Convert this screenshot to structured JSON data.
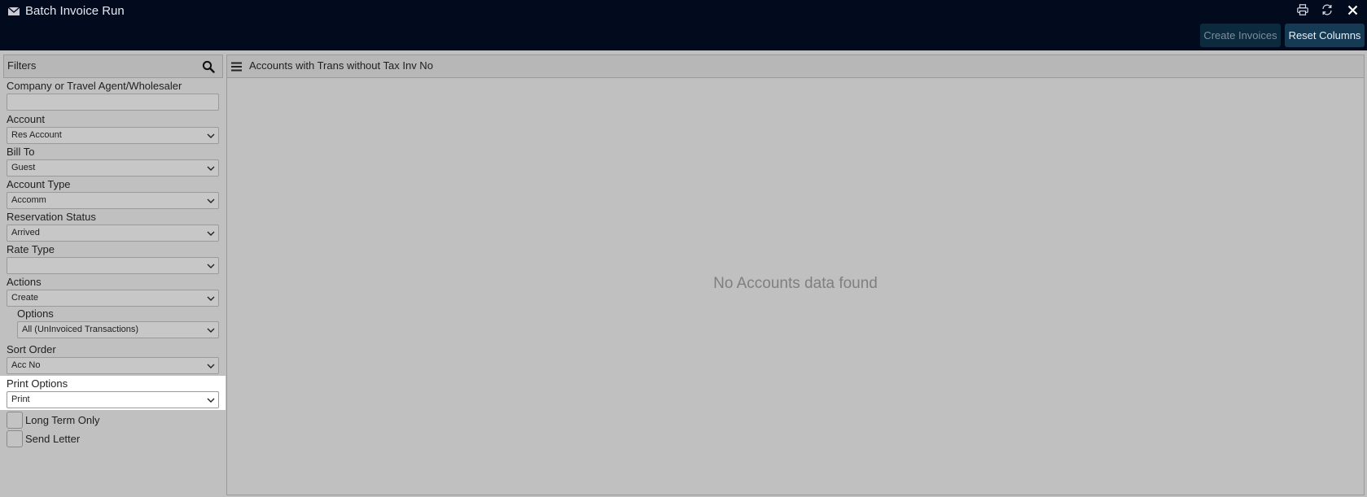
{
  "window": {
    "title": "Batch Invoice Run",
    "icons": [
      "mail-icon",
      "print-icon",
      "refresh-icon",
      "close-icon"
    ]
  },
  "toolbar": {
    "create_invoices_label": "Create Invoices",
    "reset_columns_label": "Reset Columns"
  },
  "filters": {
    "header": "Filters",
    "company_label": "Company or Travel Agent/Wholesaler",
    "company_value": "",
    "account_label": "Account",
    "account_value": "Res Account",
    "bill_to_label": "Bill To",
    "bill_to_value": "Guest",
    "account_type_label": "Account Type",
    "account_type_value": "Accomm",
    "reservation_status_label": "Reservation Status",
    "reservation_status_value": "Arrived",
    "rate_type_label": "Rate Type",
    "rate_type_value": "",
    "actions_label": "Actions",
    "actions_value": "Create",
    "options_label": "Options",
    "options_value": "All (UnInvoiced Transactions)",
    "sort_order_label": "Sort Order",
    "sort_order_value": "Acc No",
    "print_options_label": "Print Options",
    "print_options_value": "Print",
    "long_term_only_label": "Long Term Only",
    "long_term_only_checked": false,
    "send_letter_label": "Send Letter",
    "send_letter_checked": false
  },
  "main": {
    "title": "Accounts with Trans without Tax Inv No",
    "empty_message": "No Accounts data found"
  }
}
